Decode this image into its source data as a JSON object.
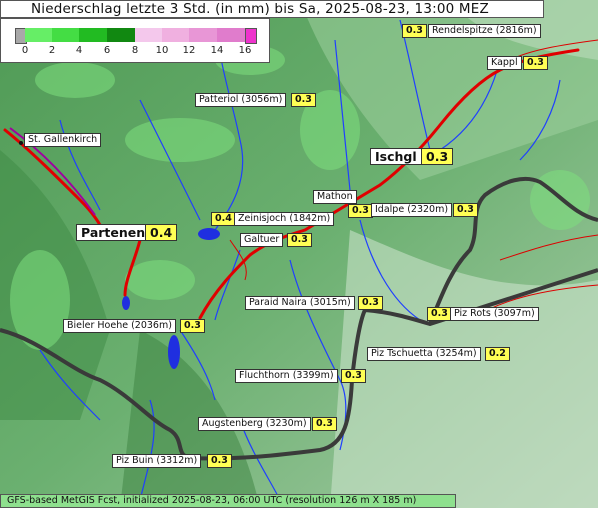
{
  "title": "Niederschlag letzte 3 Std. (in mm) bis Sa, 2025-08-23, 13:00 MEZ",
  "legend": {
    "ticks": [
      "0",
      "2",
      "4",
      "6",
      "8",
      "10",
      "12",
      "14",
      "16"
    ],
    "colors": {
      "zero": "#a8a8a8",
      "light": "#66ee66",
      "mid": "#22bb22",
      "dark": "#118811",
      "pink": "#f0b0e0",
      "magenta": "#ee33cc"
    }
  },
  "places": [
    {
      "name": "Rendelspitze (2816m)",
      "value": "0.3"
    },
    {
      "name": "Kappl",
      "value": "0.3"
    },
    {
      "name": "Patteriol (3056m)",
      "value": "0.3"
    },
    {
      "name": "St. Gallenkirch",
      "value": ""
    },
    {
      "name": "Ischgl",
      "value": "0.3"
    },
    {
      "name": "Mathon",
      "value": "0.3"
    },
    {
      "name": "Idalpe (2320m)",
      "value": "0.3"
    },
    {
      "name": "Zeinisjoch (1842m)",
      "value": "0.4"
    },
    {
      "name": "Partenen",
      "value": "0.4"
    },
    {
      "name": "Galtuer",
      "value": "0.3"
    },
    {
      "name": "Paraid Naira (3015m)",
      "value": "0.3"
    },
    {
      "name": "Piz Rots (3097m)",
      "value": "0.3"
    },
    {
      "name": "Bieler Hoehe (2036m)",
      "value": "0.3"
    },
    {
      "name": "Piz Tschuetta (3254m)",
      "value": "0.2"
    },
    {
      "name": "Fluchthorn (3399m)",
      "value": "0.3"
    },
    {
      "name": "Augstenberg (3230m)",
      "value": "0.3"
    },
    {
      "name": "Piz Buin (3312m)",
      "value": "0.3"
    }
  ],
  "footer": "GFS-based MetGIS Fcst, initialized 2025-08-23, 06:00 UTC  (resolution 126 m X 185 m)"
}
